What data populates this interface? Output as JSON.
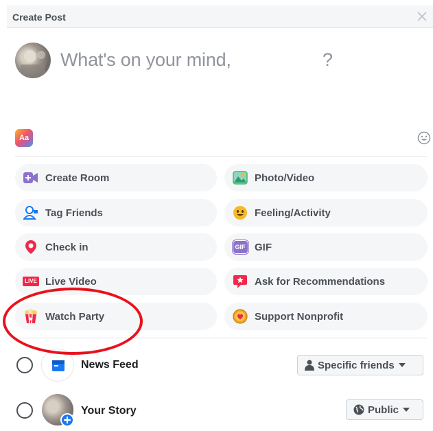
{
  "header": {
    "title": "Create Post"
  },
  "composer": {
    "placeholder": "What's on your mind,",
    "name_suffix": "?"
  },
  "options": {
    "left": [
      {
        "label": "Create Room",
        "icon": "create-room-icon"
      },
      {
        "label": "Tag Friends",
        "icon": "tag-friends-icon"
      },
      {
        "label": "Check in",
        "icon": "check-in-icon"
      },
      {
        "label": "Live Video",
        "icon": "live-video-icon"
      },
      {
        "label": "Watch Party",
        "icon": "watch-party-icon"
      }
    ],
    "right": [
      {
        "label": "Photo/Video",
        "icon": "photo-video-icon"
      },
      {
        "label": "Feeling/Activity",
        "icon": "feeling-activity-icon"
      },
      {
        "label": "GIF",
        "icon": "gif-icon"
      },
      {
        "label": "Ask for Recommendations",
        "icon": "ask-recommendations-icon"
      },
      {
        "label": "Support Nonprofit",
        "icon": "support-nonprofit-icon"
      }
    ]
  },
  "icons": {
    "live_badge": "LIVE",
    "gif_badge": "GIF",
    "text_style": "Aa"
  },
  "share": {
    "news_feed": {
      "label": "News Feed",
      "audience": "Specific friends"
    },
    "your_story": {
      "label": "Your Story",
      "audience": "Public"
    }
  },
  "colors": {
    "accent_blue": "#1877f2",
    "annotation_red": "#e8121c",
    "option_bg": "#f5f6f7"
  }
}
